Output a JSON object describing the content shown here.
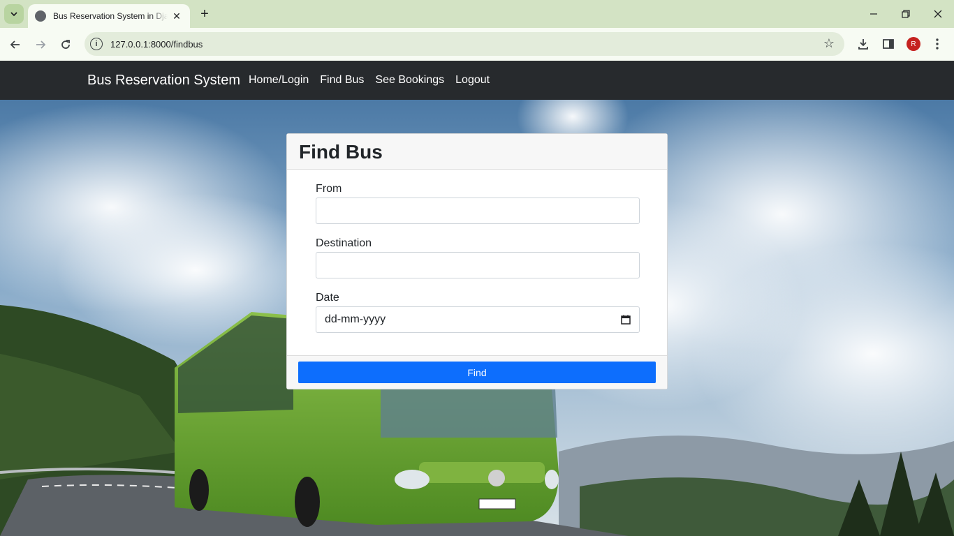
{
  "browser": {
    "tab_title": "Bus Reservation System in Django",
    "url": "127.0.0.1:8000/findbus",
    "profile_initial": "R",
    "accent": "#d3e3c4"
  },
  "navbar": {
    "brand": "Bus Reservation System",
    "links": [
      "Home/Login",
      "Find Bus",
      "See Bookings",
      "Logout"
    ]
  },
  "form": {
    "title": "Find Bus",
    "from_label": "From",
    "from_value": "",
    "destination_label": "Destination",
    "destination_value": "",
    "date_label": "Date",
    "date_placeholder": "dd-mm-yyyy",
    "submit_label": "Find",
    "submit_color": "#0d6efd"
  }
}
